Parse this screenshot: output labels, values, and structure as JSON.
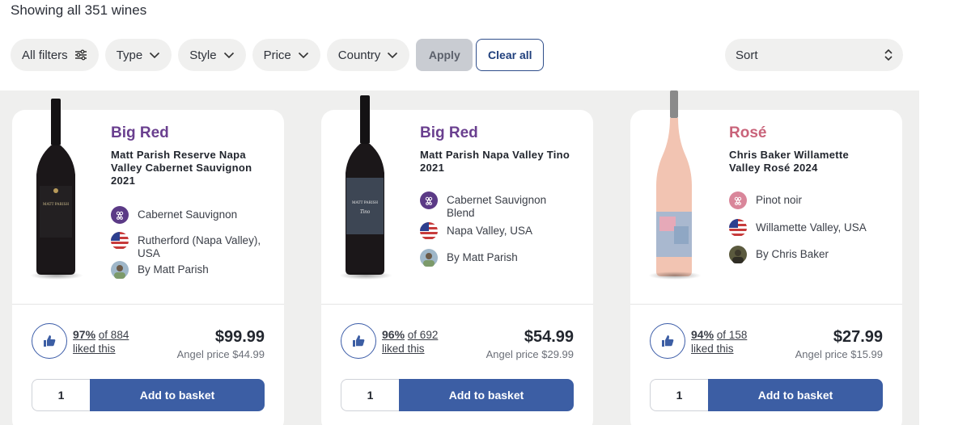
{
  "results": {
    "count_text": "Showing all 351 wines"
  },
  "filters": [
    {
      "label": "All filters",
      "icon": "sliders-icon"
    },
    {
      "label": "Type",
      "icon": "chevron-down-icon"
    },
    {
      "label": "Style",
      "icon": "chevron-down-icon"
    },
    {
      "label": "Price",
      "icon": "chevron-down-icon"
    },
    {
      "label": "Country",
      "icon": "chevron-down-icon"
    }
  ],
  "actions": {
    "apply_label": "Apply",
    "clear_label": "Clear all"
  },
  "sort": {
    "label": "Sort",
    "icon": "sort-updown-icon"
  },
  "products": [
    {
      "style": "Big Red",
      "style_color": "#6a3f8f",
      "name": "Matt Parish Reserve Napa Valley Cabernet Sauvignon 2021",
      "grape": "Cabernet Sauvignon",
      "region": "Rutherford (Napa Valley), USA",
      "maker": "By Matt Parish",
      "rating_pct": "97%",
      "rating_of": "of 884",
      "rating_liked": "liked this",
      "price": "$99.99",
      "angel_price": "Angel price $44.99",
      "qty": "1",
      "button": "Add to basket"
    },
    {
      "style": "Big Red",
      "style_color": "#6a3f8f",
      "name": "Matt Parish Napa Valley Tino 2021",
      "grape": "Cabernet Sauvignon Blend",
      "region": "Napa Valley, USA",
      "maker": "By Matt Parish",
      "rating_pct": "96%",
      "rating_of": "of 692",
      "rating_liked": "liked this",
      "price": "$54.99",
      "angel_price": "Angel price $29.99",
      "qty": "1",
      "button": "Add to basket"
    },
    {
      "style": "Rosé",
      "style_color": "#c9637a",
      "name": "Chris Baker Willamette Valley Rosé 2024",
      "grape": "Pinot noir",
      "region": "Willamette Valley, USA",
      "maker": "By Chris Baker",
      "rating_pct": "94%",
      "rating_of": "of 158",
      "rating_liked": "liked this",
      "price": "$27.99",
      "angel_price": "Angel price $15.99",
      "qty": "1",
      "button": "Add to basket"
    }
  ],
  "colors": {
    "accent": "#3c5ea4",
    "background": "#efefee",
    "pill": "#f0f0ef"
  },
  "icons": {
    "grape": "grape-icon",
    "flag": "us-flag-icon",
    "thumb": "thumbs-up-icon",
    "maker": "winemaker-avatar-icon"
  }
}
